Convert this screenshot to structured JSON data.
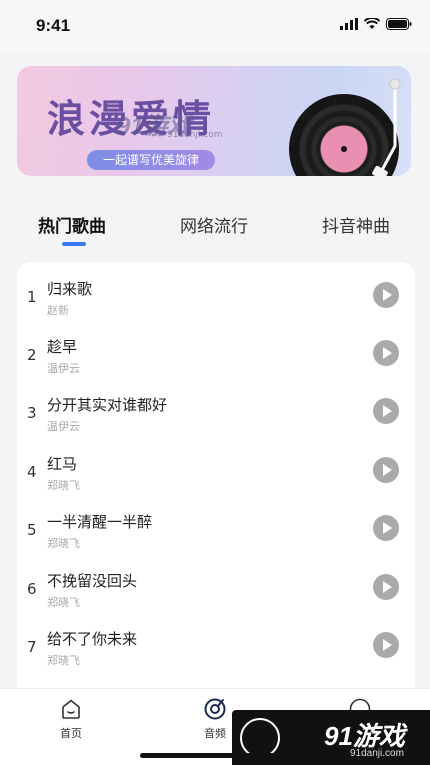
{
  "status_bar": {
    "time": "9:41"
  },
  "banner": {
    "title": "浪漫爱情",
    "subtitle": "一起谱写优美旋律",
    "watermark_logo": "91游戏",
    "watermark_url": "91danji.com"
  },
  "tabs": [
    {
      "label": "热门歌曲",
      "active": true
    },
    {
      "label": "网络流行",
      "active": false
    },
    {
      "label": "抖音神曲",
      "active": false
    }
  ],
  "songs": [
    {
      "num": "1",
      "title": "归来歌",
      "artist": "赵新"
    },
    {
      "num": "2",
      "title": "趁早",
      "artist": "温伊云"
    },
    {
      "num": "3",
      "title": "分开其实对谁都好",
      "artist": "温伊云"
    },
    {
      "num": "4",
      "title": "红马",
      "artist": "郑晓飞"
    },
    {
      "num": "5",
      "title": "一半清醒一半醉",
      "artist": "郑晓飞"
    },
    {
      "num": "6",
      "title": "不挽留没回头",
      "artist": "郑晓飞"
    },
    {
      "num": "7",
      "title": "给不了你未来",
      "artist": "郑晓飞"
    }
  ],
  "bottom_nav": [
    {
      "label": "首页",
      "icon": "home-icon"
    },
    {
      "label": "音频",
      "icon": "record-icon"
    },
    {
      "label": "",
      "icon": "profile-icon"
    }
  ],
  "watermark": {
    "logo": "91游戏",
    "url": "91danji.com"
  },
  "colors": {
    "accent": "#3b7bf2",
    "play_button": "#aaaaaa",
    "background": "#f3f4f6"
  }
}
